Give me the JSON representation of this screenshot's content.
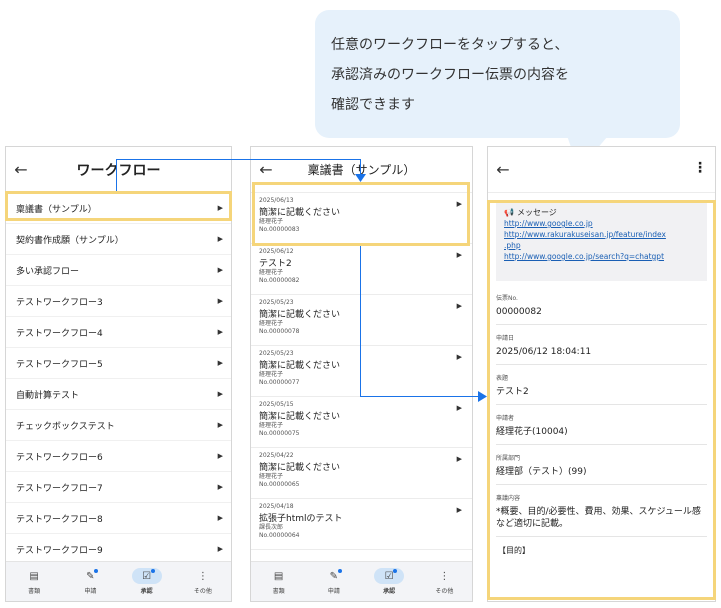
{
  "bubble": {
    "lines": [
      "任意のワークフローをタップすると、",
      "承認済みのワークフロー伝票の内容を",
      "確認できます"
    ]
  },
  "icons": {
    "back": "arrow-left-icon",
    "chevron": "chevron-right-icon",
    "more": "more-vert-icon",
    "megaphone": "megaphone-icon"
  },
  "colors": {
    "highlight": "#f5d57a",
    "arrow": "#1a73e8",
    "link": "#1a5fb4",
    "active_tab_bg": "#cfe3f7"
  },
  "phone1": {
    "title": "ワークフロー",
    "items": [
      "稟議書（サンプル）",
      "契約書作成願（サンプル）",
      "多い承認フロー",
      "テストワークフロー3",
      "テストワークフロー4",
      "テストワークフロー5",
      "自動計算テスト",
      "チェックボックステスト",
      "テストワークフロー6",
      "テストワークフロー7",
      "テストワークフロー8",
      "テストワークフロー9"
    ]
  },
  "phone2": {
    "title": "稟議書（サンプル）",
    "docs": [
      {
        "date": "2025/06/13",
        "title": "簡潔に記載ください",
        "person": "経理花子",
        "no": "No.00000083"
      },
      {
        "date": "2025/06/12",
        "title": "テスト2",
        "person": "経理花子",
        "no": "No.00000082"
      },
      {
        "date": "2025/05/23",
        "title": "簡潔に記載ください",
        "person": "経理花子",
        "no": "No.00000078"
      },
      {
        "date": "2025/05/23",
        "title": "簡潔に記載ください",
        "person": "経理花子",
        "no": "No.00000077"
      },
      {
        "date": "2025/05/15",
        "title": "簡潔に記載ください",
        "person": "経理花子",
        "no": "No.00000075"
      },
      {
        "date": "2025/04/22",
        "title": "簡潔に記載ください",
        "person": "経理花子",
        "no": "No.00000065"
      },
      {
        "date": "2025/04/18",
        "title": "拡張子htmlのテスト",
        "person": "課長次郎",
        "no": "No.00000064"
      }
    ]
  },
  "phone3": {
    "message_header": "メッセージ",
    "links": [
      "http://www.google.co.jp",
      "http://www.rakurakuseisan.jp/feature/index",
      ".php",
      "http://www.google.co.jp/search?q=chatgpt"
    ],
    "fields": [
      {
        "label": "伝票No.",
        "value": "00000082"
      },
      {
        "label": "申請日",
        "value": "2025/06/12 18:04:11"
      },
      {
        "label": "表題",
        "value": "テスト2"
      },
      {
        "label": "申請者",
        "value": "経理花子(10004)"
      },
      {
        "label": "所属部門",
        "value": "経理部（テスト）(99)"
      },
      {
        "label": "稟議内容",
        "value": "*概要、目的/必要性、費用、効果、スケジュール感など適切に記載。"
      }
    ],
    "footer_text": "【目的】"
  },
  "tabbar": [
    {
      "label": "書類",
      "icon": "document-icon",
      "active": false,
      "dot": false
    },
    {
      "label": "申請",
      "icon": "edit-icon",
      "active": false,
      "dot": true
    },
    {
      "label": "承認",
      "icon": "approve-icon",
      "active": true,
      "dot": true
    },
    {
      "label": "その他",
      "icon": "more-vert-icon",
      "active": false,
      "dot": false
    }
  ]
}
